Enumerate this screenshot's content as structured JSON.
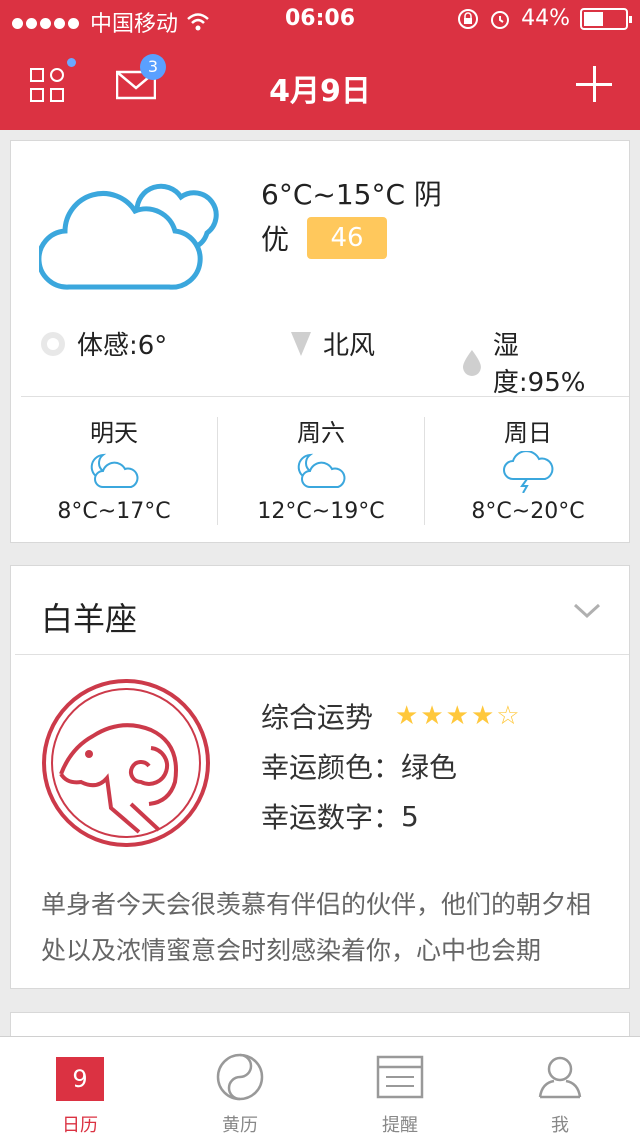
{
  "status_bar": {
    "carrier": "中国移动",
    "time": "06:06",
    "battery": "44%",
    "battery_level": 0.44
  },
  "header": {
    "title": "4月9日",
    "mail_badge": "3"
  },
  "weather": {
    "temp_range": "6°C~15°C",
    "condition": "阴",
    "aqi_label": "优",
    "aqi_value": "46",
    "feels_like": "体感:6°",
    "wind": "北风",
    "humidity": "湿度:95%",
    "forecast": [
      {
        "day": "明天",
        "temp": "8°C~17°C",
        "icon": "moon-cloud-icon"
      },
      {
        "day": "周六",
        "temp": "12°C~19°C",
        "icon": "moon-cloud-icon"
      },
      {
        "day": "周日",
        "temp": "8°C~20°C",
        "icon": "thunder-cloud-icon"
      }
    ]
  },
  "horoscope": {
    "sign": "白羊座",
    "overall_label": "综合运势",
    "overall_rating": 4,
    "overall_max": 5,
    "lucky_color_label": "幸运颜色：",
    "lucky_color": "绿色",
    "lucky_number_label": "幸运数字：",
    "lucky_number": "5",
    "description": "单身者今天会很羡慕有伴侣的伙伴，他们的朝夕相处以及浓情蜜意会时刻感染着你，心中也会期"
  },
  "tabbar": {
    "calendar_day": "9",
    "tabs": [
      {
        "label": "日历",
        "icon": "calendar-icon",
        "active": true
      },
      {
        "label": "黄历",
        "icon": "yinyang-icon",
        "active": false
      },
      {
        "label": "提醒",
        "icon": "reminder-icon",
        "active": false
      },
      {
        "label": "我",
        "icon": "user-icon",
        "active": false
      }
    ]
  },
  "colors": {
    "accent": "#db3242",
    "aqi_good": "#ffc85c",
    "weather_icon": "#3ba7dd",
    "star": "#ffc83c"
  }
}
